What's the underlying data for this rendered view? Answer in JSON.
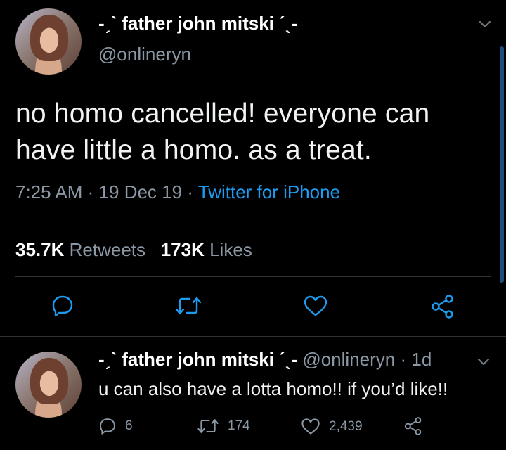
{
  "main_tweet": {
    "display_name": "-ˏˋ father john mitski ˊˎ-",
    "handle": "@onlineryn",
    "text": "no homo cancelled! everyone can have little a homo. as a treat.",
    "time": "7:25 AM",
    "date": "19 Dec 19",
    "separator": "·",
    "source": "Twitter for iPhone",
    "retweets_count": "35.7K",
    "retweets_label": "Retweets",
    "likes_count": "173K",
    "likes_label": "Likes"
  },
  "reply_tweet": {
    "display_name": "-ˏˋ father john mitski ˊˎ-",
    "handle": "@onlineryn",
    "separator": "·",
    "age": "1d",
    "text": "u can also have a lotta homo!! if you’d like!!",
    "replies": "6",
    "retweets": "174",
    "likes": "2,439"
  },
  "icons": {
    "reply": "reply-icon",
    "retweet": "retweet-icon",
    "like": "heart-icon",
    "share": "share-icon",
    "menu": "chevron-down-icon"
  },
  "colors": {
    "background": "#000000",
    "accent": "#1d9bf0",
    "muted": "#8b98a5",
    "divider": "#2f3336"
  }
}
